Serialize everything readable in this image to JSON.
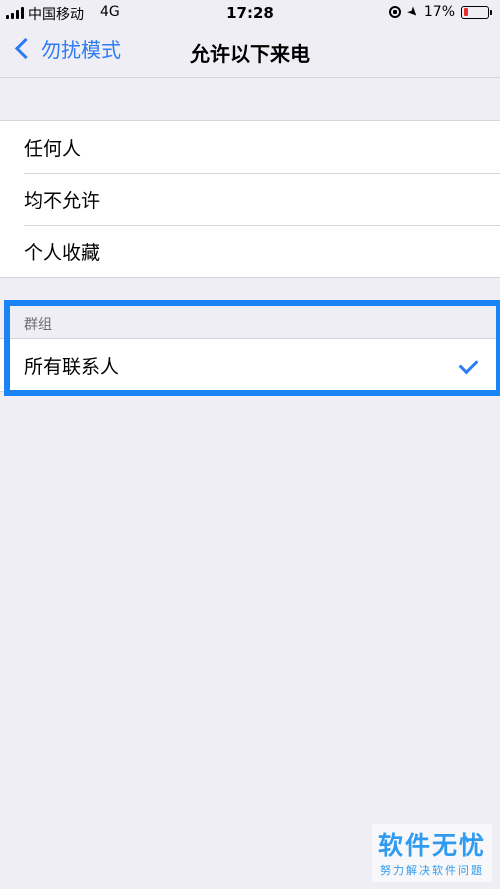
{
  "status_bar": {
    "carrier": "中国移动",
    "network": "4G",
    "time": "17:28",
    "battery_percent": "17%",
    "battery_color": "#e5302b"
  },
  "nav": {
    "back_label": "勿扰模式",
    "title": "允许以下来电",
    "accent_color": "#2e7bf6"
  },
  "options": [
    {
      "label": "任何人"
    },
    {
      "label": "均不允许"
    },
    {
      "label": "个人收藏"
    }
  ],
  "groups_section": {
    "header": "群组",
    "items": [
      {
        "label": "所有联系人",
        "selected": true
      }
    ]
  },
  "watermark": {
    "title": "软件无忧",
    "subtitle": "努力解决软件问题"
  }
}
